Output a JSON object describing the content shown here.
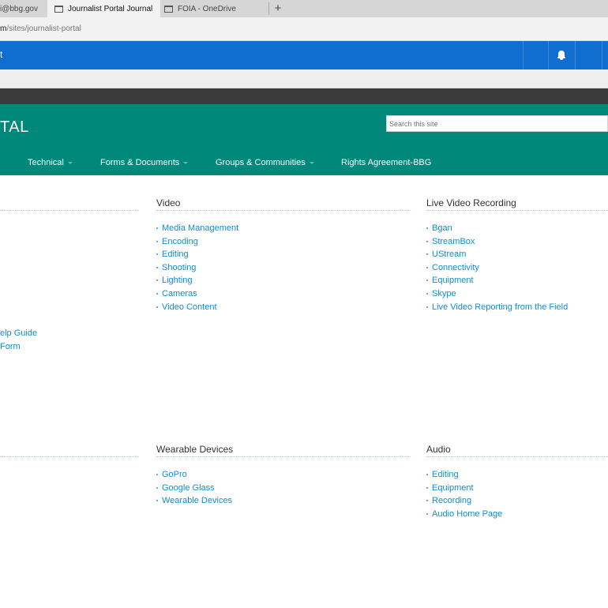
{
  "browser": {
    "tabs": [
      {
        "label": "i@bbg.gov",
        "active": false
      },
      {
        "label": "Journalist Portal Journal",
        "active": true
      },
      {
        "label": "FOIA - OneDrive",
        "active": false
      }
    ],
    "new_tab_glyph": "+",
    "close_glyph": "✕",
    "address": {
      "host": "m",
      "path": "/sites/journalist-portal"
    }
  },
  "suitebar": {
    "left_glyph": "t",
    "bell_icon": "bell-icon"
  },
  "site": {
    "title": "TAL",
    "search_placeholder": "Search this site",
    "nav": [
      {
        "label": "Technical",
        "has_caret": true
      },
      {
        "label": "Forms & Documents",
        "has_caret": true
      },
      {
        "label": "Groups & Communities",
        "has_caret": true
      },
      {
        "label": "Rights Agreement-BBG",
        "has_caret": false
      }
    ]
  },
  "content": {
    "left_links": [
      "elp Guide",
      "Form"
    ],
    "sections": [
      {
        "title": "Video",
        "links": [
          "Media Management",
          "Encoding",
          "Editing",
          "Shooting",
          "Lighting",
          "Cameras",
          "Video Content"
        ]
      },
      {
        "title": "Live Video Recording",
        "links": [
          "Bgan",
          "StreamBox",
          "UStream",
          "Connectivity",
          "Equipment",
          "Skype",
          "Live Video Reporting from the Field"
        ]
      },
      {
        "title": "Wearable Devices",
        "links": [
          "GoPro",
          "Google Glass",
          "Wearable Devices"
        ]
      },
      {
        "title": "Audio",
        "links": [
          "Editing",
          "Equipment",
          "Recording",
          "Audio Home Page"
        ]
      }
    ]
  },
  "colors": {
    "suitebar": "#0f6ecf",
    "site_header": "#00897b",
    "link": "#0f8dd4",
    "dark_ribbon": "#3b3b3b"
  }
}
